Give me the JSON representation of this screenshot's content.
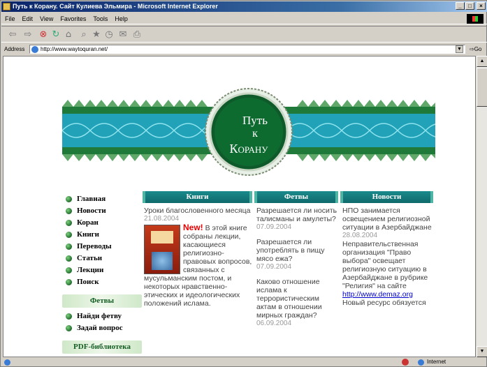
{
  "window": {
    "title": "Путь к Корану. Сайт Кулиева Эльмира - Microsoft Internet Explorer",
    "min": "_",
    "max": "□",
    "close": "×"
  },
  "menu": [
    "File",
    "Edit",
    "View",
    "Favorites",
    "Tools",
    "Help"
  ],
  "address": {
    "label": "Address",
    "url": "http://www.waytoquran.net/",
    "go": "Go"
  },
  "status": {
    "zone": "Internet"
  },
  "banner": {
    "line1": "Путь",
    "line2": "к",
    "line3": "Корану"
  },
  "nav": {
    "items": [
      "Главная",
      "Новости",
      "Коран",
      "Книги",
      "Переводы",
      "Статьи",
      "Лекции",
      "Поиск"
    ],
    "fatwa_head": "Фетвы",
    "fatwa_items": [
      "Найди фетву",
      "Задай вопрос"
    ],
    "pdf_head": "PDF-библиотека"
  },
  "books": {
    "head": "Книги",
    "title": "Уроки благословенного месяца",
    "date": "21.08.2004",
    "new_label": "New!",
    "text": "В этой книге собраны лекции, касающиеся религиозно-правовых вопросов, связанных с мусульманским постом, и некоторых нравственно-этических и идеологических положений ислама."
  },
  "fatwas": {
    "head": "Фетвы",
    "items": [
      {
        "q": "Разрешается ли носить талисманы и амулеты?",
        "date": "07.09.2004"
      },
      {
        "q": "Разрешается ли употреблять в пищу мясо ежа?",
        "date": "07.09.2004"
      },
      {
        "q": "Каково отношение ислама к террористическим актам в отношении мирных граждан?",
        "date": "06.09.2004"
      }
    ]
  },
  "news": {
    "head": "Новости",
    "title": "НПО занимается освещением религиозной ситуации в Азербайджане",
    "date": "28.08.2004",
    "text": "Неправительственная организация \"Право выбора\" освещает религиозную ситуацию в Азербайджане в рубрике \"Религия\" на сайте",
    "link": "http://www.demaz.org",
    "more": "Новый ресурс обязуется"
  }
}
